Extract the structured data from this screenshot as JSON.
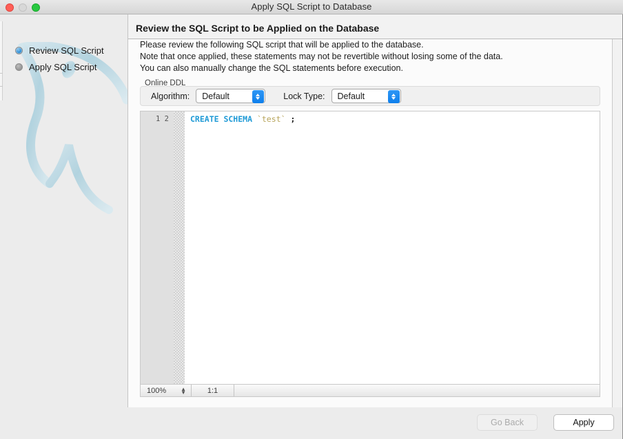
{
  "window": {
    "title": "Apply SQL Script to Database",
    "controls": {
      "close": "close-button",
      "minimize": "minimize-button",
      "zoom": "zoom-button"
    }
  },
  "sidebar": {
    "steps": [
      {
        "label": "Review SQL Script",
        "state": "active"
      },
      {
        "label": "Apply SQL Script",
        "state": "inactive"
      }
    ],
    "watermark": "mysql-dolphin-logo"
  },
  "main": {
    "heading": "Review the SQL Script to be Applied on the Database",
    "intro_lines": [
      "Please review the following SQL script that will be applied to the database.",
      "Note that once applied, these statements may not be revertible without losing some of the data.",
      "You can also manually change the SQL statements before execution."
    ],
    "online_ddl": {
      "legend": "Online DDL",
      "algorithm": {
        "label": "Algorithm:",
        "value": "Default"
      },
      "lock_type": {
        "label": "Lock Type:",
        "value": "Default"
      }
    },
    "editor": {
      "line_numbers": [
        "1",
        "2"
      ],
      "tokens": [
        {
          "text": "CREATE SCHEMA",
          "type": "keyword"
        },
        {
          "text": " ",
          "type": "plain"
        },
        {
          "text": "`test`",
          "type": "identifier"
        },
        {
          "text": " ",
          "type": "plain"
        },
        {
          "text": ";",
          "type": "punctuation"
        }
      ],
      "code_text": "CREATE SCHEMA `test` ;",
      "status": {
        "zoom": "100%",
        "cursor_position": "1:1"
      }
    }
  },
  "footer": {
    "go_back": {
      "label": "Go Back",
      "enabled": false
    },
    "apply": {
      "label": "Apply",
      "enabled": true
    }
  },
  "colors": {
    "window_chrome": "#ececec",
    "panel_background": "#fbfbfb",
    "accent_blue": "#0d7fec",
    "keyword_blue": "#1f9ad6",
    "identifier_tan": "#b8a55c",
    "close_red": "#ff5f57",
    "zoom_green": "#28c840",
    "dolphin_blue": "#a9cfdd"
  }
}
